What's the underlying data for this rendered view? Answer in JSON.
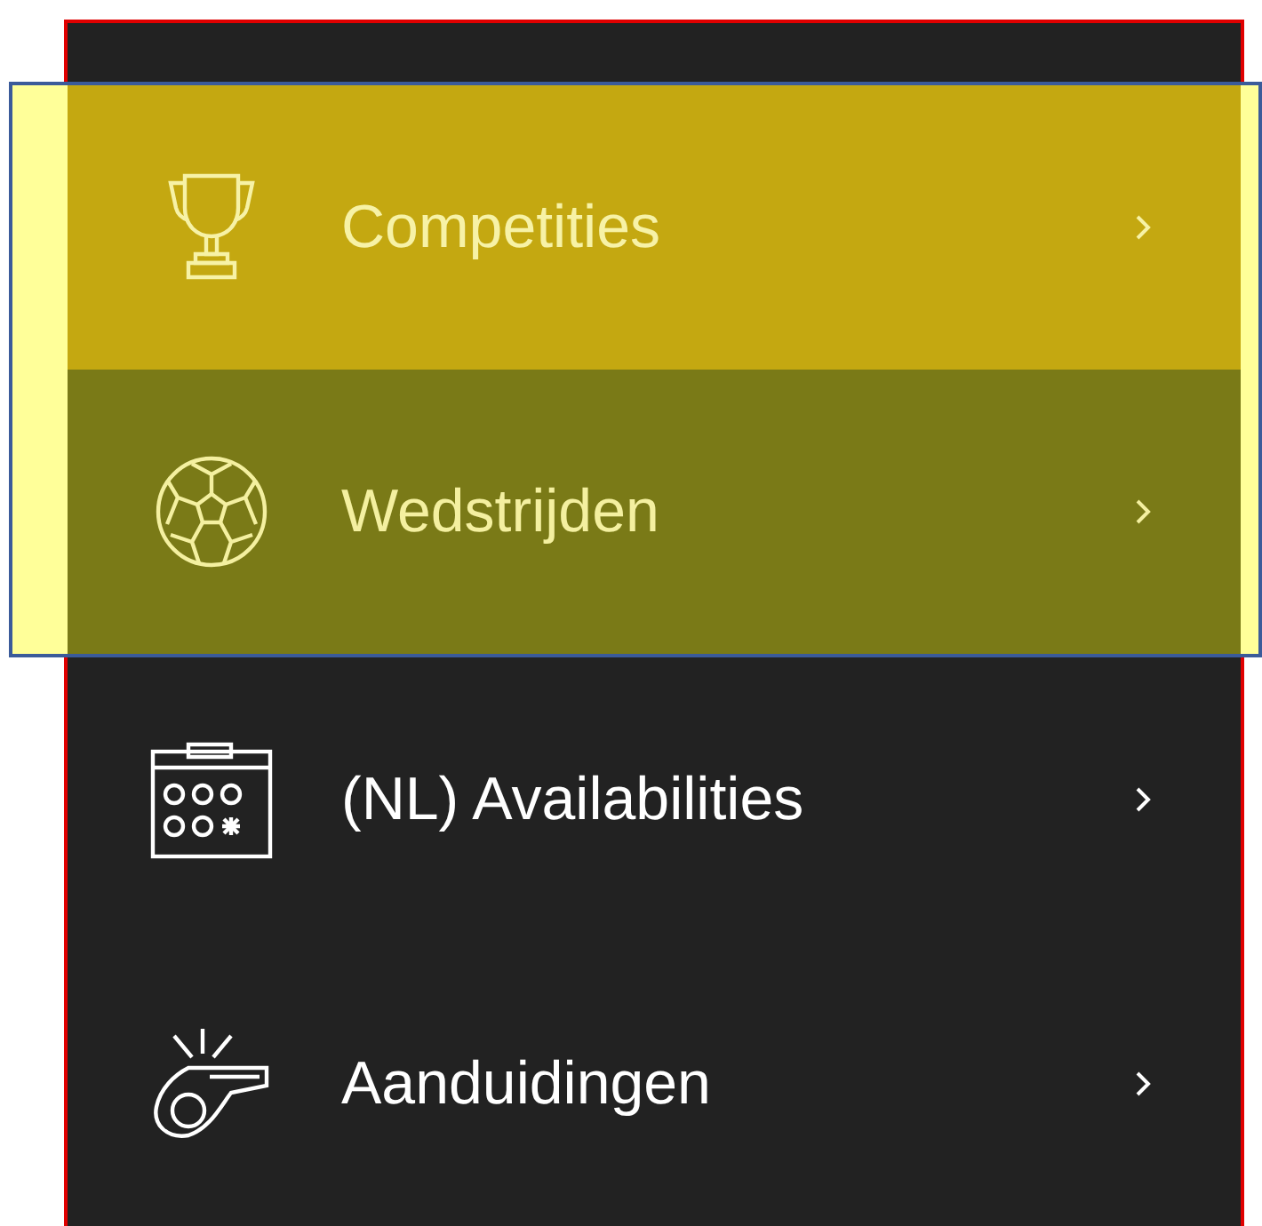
{
  "menu": {
    "items": [
      {
        "label": "Competities",
        "kind": "trophy",
        "highlighted": true,
        "selected": true
      },
      {
        "label": "Wedstrijden",
        "kind": "ball",
        "highlighted": true,
        "selected": false
      },
      {
        "label": "(NL) Availabilities",
        "kind": "calendar",
        "highlighted": false,
        "selected": false
      },
      {
        "label": "Aanduidingen",
        "kind": "whistle",
        "highlighted": false,
        "selected": false
      }
    ]
  }
}
